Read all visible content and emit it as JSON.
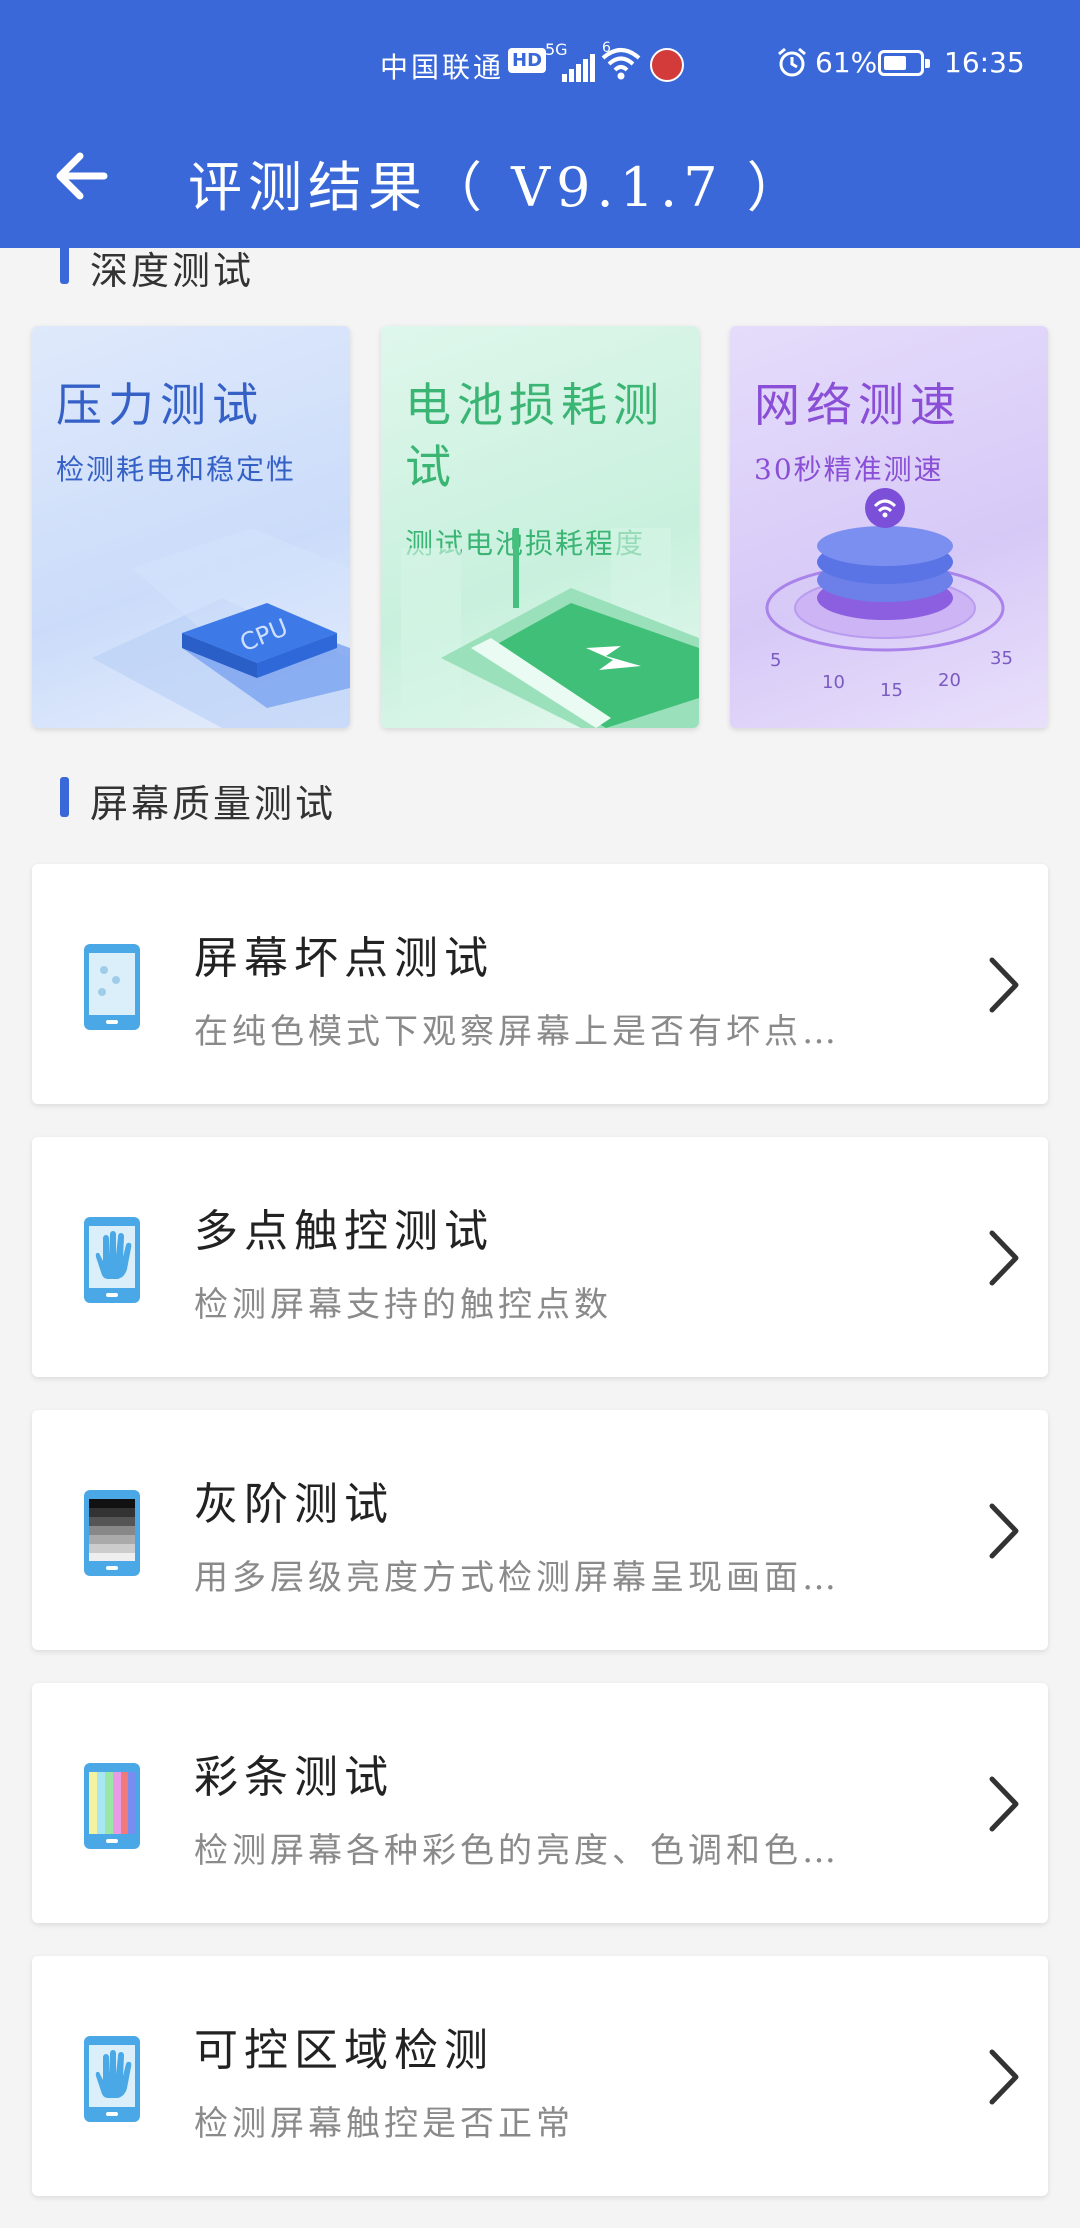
{
  "status_bar": {
    "carrier": "中国联通",
    "hd": "HD",
    "network": "5G",
    "wifi_badge": "6",
    "battery_percent": "61%",
    "time": "16:35"
  },
  "header": {
    "title": "评测结果（ V9.1.7 ）"
  },
  "sections": {
    "deep": "深度测试",
    "screen": "屏幕质量测试"
  },
  "cards": [
    {
      "title": "压力测试",
      "subtitle": "检测耗电和稳定性",
      "chip": "CPU"
    },
    {
      "title": "电池损耗测试",
      "subtitle": "测试电池损耗程度"
    },
    {
      "title": "网络测速",
      "subtitle": "30秒精准测速",
      "gauge_ticks": [
        "5",
        "10",
        "15",
        "20",
        "35"
      ]
    }
  ],
  "items": [
    {
      "title": "屏幕坏点测试",
      "desc": "在纯色模式下观察屏幕上是否有坏点…",
      "icon": "dead-pixel-phone-icon"
    },
    {
      "title": "多点触控测试",
      "desc": "检测屏幕支持的触控点数",
      "icon": "touch-hand-phone-icon"
    },
    {
      "title": "灰阶测试",
      "desc": "用多层级亮度方式检测屏幕呈现画面…",
      "icon": "grayscale-phone-icon"
    },
    {
      "title": "彩条测试",
      "desc": "检测屏幕各种彩色的亮度、色调和色…",
      "icon": "colorbar-phone-icon"
    },
    {
      "title": "可控区域检测",
      "desc": "检测屏幕触控是否正常",
      "icon": "touch-hand-phone-icon"
    }
  ],
  "colors": {
    "accent": "#3a68d8",
    "icon_blue": "#4aa8e6"
  }
}
